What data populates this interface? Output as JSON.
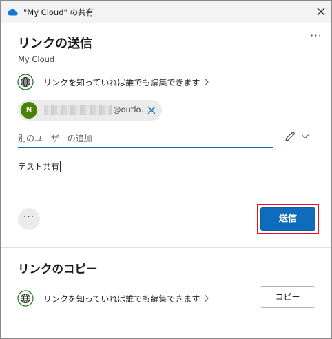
{
  "window": {
    "title": "\"My Cloud\" の共有",
    "app_icon": "cloud-icon",
    "close_icon": "close-icon"
  },
  "send_link": {
    "heading": "リンクの送信",
    "subtitle": "My Cloud",
    "more_label": "···",
    "permission_text": "リンクを知っていれば誰でも編集できます",
    "recipient": {
      "initial": "N",
      "email_suffix": "@outlo…"
    },
    "add_user_placeholder": "別のユーザーの追加",
    "message": "テスト共有",
    "options_label": "···",
    "send_label": "送信"
  },
  "copy_link": {
    "heading": "リンクのコピー",
    "permission_text": "リンクを知っていれば誰でも編集できます",
    "copy_label": "コピー"
  },
  "colors": {
    "accent": "#0f6cbd",
    "avatar": "#498205",
    "highlight_outline": "#e81123",
    "globe": "#107c10"
  }
}
